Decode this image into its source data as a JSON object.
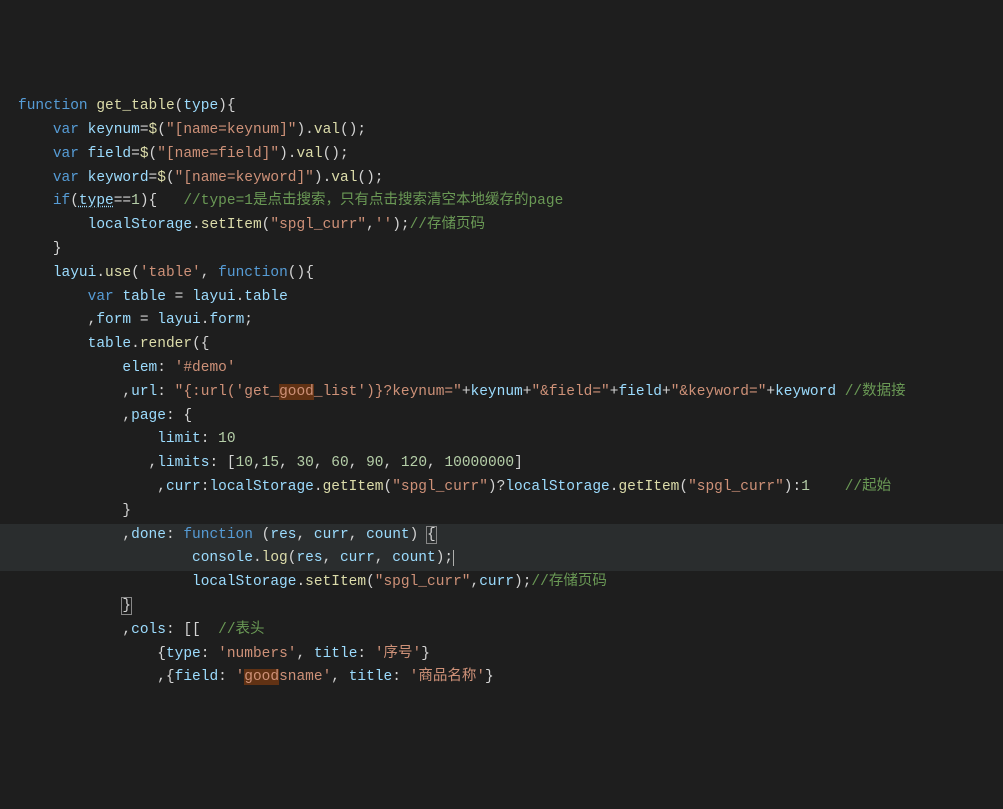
{
  "language": "javascript",
  "theme": "dark",
  "cursor_line": 19,
  "cursor_col": 55,
  "highlighted_lines": [
    19,
    20
  ],
  "code_lines": [
    {
      "tokens": [
        {
          "t": "function",
          "c": "kw"
        },
        {
          "t": " ",
          "c": "op"
        },
        {
          "t": "get_table",
          "c": "fn"
        },
        {
          "t": "(",
          "c": "pun"
        },
        {
          "t": "type",
          "c": "var"
        },
        {
          "t": "){",
          "c": "pun"
        }
      ]
    },
    {
      "indent": 4,
      "tokens": [
        {
          "t": "var",
          "c": "kw"
        },
        {
          "t": " ",
          "c": "op"
        },
        {
          "t": "keynum",
          "c": "var"
        },
        {
          "t": "=",
          "c": "op"
        },
        {
          "t": "$",
          "c": "fn"
        },
        {
          "t": "(",
          "c": "pun"
        },
        {
          "t": "\"[name=keynum]\"",
          "c": "str"
        },
        {
          "t": ").",
          "c": "pun"
        },
        {
          "t": "val",
          "c": "fn"
        },
        {
          "t": "();",
          "c": "pun"
        }
      ]
    },
    {
      "indent": 4,
      "tokens": [
        {
          "t": "var",
          "c": "kw"
        },
        {
          "t": " ",
          "c": "op"
        },
        {
          "t": "field",
          "c": "var"
        },
        {
          "t": "=",
          "c": "op"
        },
        {
          "t": "$",
          "c": "fn"
        },
        {
          "t": "(",
          "c": "pun"
        },
        {
          "t": "\"[name=field]\"",
          "c": "str"
        },
        {
          "t": ").",
          "c": "pun"
        },
        {
          "t": "val",
          "c": "fn"
        },
        {
          "t": "();",
          "c": "pun"
        }
      ]
    },
    {
      "indent": 4,
      "tokens": [
        {
          "t": "var",
          "c": "kw"
        },
        {
          "t": " ",
          "c": "op"
        },
        {
          "t": "keyword",
          "c": "var"
        },
        {
          "t": "=",
          "c": "op"
        },
        {
          "t": "$",
          "c": "fn"
        },
        {
          "t": "(",
          "c": "pun"
        },
        {
          "t": "\"[name=keyword]\"",
          "c": "str"
        },
        {
          "t": ").",
          "c": "pun"
        },
        {
          "t": "val",
          "c": "fn"
        },
        {
          "t": "();",
          "c": "pun"
        }
      ]
    },
    {
      "indent": 4,
      "tokens": [
        {
          "t": "if",
          "c": "kw"
        },
        {
          "t": "(",
          "c": "pun"
        },
        {
          "t": "type",
          "c": "var",
          "u": true
        },
        {
          "t": "==",
          "c": "op"
        },
        {
          "t": "1",
          "c": "num"
        },
        {
          "t": "){   ",
          "c": "pun"
        },
        {
          "t": "//type=1是点击搜索，只有点击搜索清空本地缓存的page",
          "c": "cmt"
        }
      ]
    },
    {
      "indent": 8,
      "tokens": [
        {
          "t": "localStorage",
          "c": "var"
        },
        {
          "t": ".",
          "c": "pun"
        },
        {
          "t": "setItem",
          "c": "fn"
        },
        {
          "t": "(",
          "c": "pun"
        },
        {
          "t": "\"spgl_curr\"",
          "c": "str"
        },
        {
          "t": ",",
          "c": "pun"
        },
        {
          "t": "''",
          "c": "str"
        },
        {
          "t": ");",
          "c": "pun"
        },
        {
          "t": "//存储页码",
          "c": "cmt"
        }
      ]
    },
    {
      "indent": 4,
      "tokens": [
        {
          "t": "}",
          "c": "pun"
        }
      ]
    },
    {
      "indent": 4,
      "tokens": [
        {
          "t": "layui",
          "c": "var"
        },
        {
          "t": ".",
          "c": "pun"
        },
        {
          "t": "use",
          "c": "fn"
        },
        {
          "t": "(",
          "c": "pun"
        },
        {
          "t": "'table'",
          "c": "str"
        },
        {
          "t": ", ",
          "c": "pun"
        },
        {
          "t": "function",
          "c": "kw"
        },
        {
          "t": "(){",
          "c": "pun"
        }
      ]
    },
    {
      "indent": 8,
      "tokens": [
        {
          "t": "var",
          "c": "kw"
        },
        {
          "t": " ",
          "c": "op"
        },
        {
          "t": "table",
          "c": "var"
        },
        {
          "t": " = ",
          "c": "op"
        },
        {
          "t": "layui",
          "c": "var"
        },
        {
          "t": ".",
          "c": "pun"
        },
        {
          "t": "table",
          "c": "var"
        }
      ]
    },
    {
      "indent": 8,
      "tokens": [
        {
          "t": ",",
          "c": "pun"
        },
        {
          "t": "form",
          "c": "var"
        },
        {
          "t": " = ",
          "c": "op"
        },
        {
          "t": "layui",
          "c": "var"
        },
        {
          "t": ".",
          "c": "pun"
        },
        {
          "t": "form",
          "c": "var"
        },
        {
          "t": ";",
          "c": "pun"
        }
      ]
    },
    {
      "indent": 8,
      "tokens": [
        {
          "t": "table",
          "c": "var"
        },
        {
          "t": ".",
          "c": "pun"
        },
        {
          "t": "render",
          "c": "fn"
        },
        {
          "t": "({",
          "c": "pun"
        }
      ]
    },
    {
      "indent": 12,
      "tokens": [
        {
          "t": "elem",
          "c": "var"
        },
        {
          "t": ": ",
          "c": "pun"
        },
        {
          "t": "'#demo'",
          "c": "str"
        }
      ]
    },
    {
      "indent": 12,
      "tokens": [
        {
          "t": ",",
          "c": "pun"
        },
        {
          "t": "url",
          "c": "var"
        },
        {
          "t": ": ",
          "c": "pun"
        },
        {
          "t": "\"{:url('get_",
          "c": "str"
        },
        {
          "t": "good",
          "c": "str",
          "box": true
        },
        {
          "t": "_list')}?keynum=\"",
          "c": "str"
        },
        {
          "t": "+",
          "c": "op"
        },
        {
          "t": "keynum",
          "c": "var"
        },
        {
          "t": "+",
          "c": "op"
        },
        {
          "t": "\"&field=\"",
          "c": "str"
        },
        {
          "t": "+",
          "c": "op"
        },
        {
          "t": "field",
          "c": "var"
        },
        {
          "t": "+",
          "c": "op"
        },
        {
          "t": "\"&keyword=\"",
          "c": "str"
        },
        {
          "t": "+",
          "c": "op"
        },
        {
          "t": "keyword",
          "c": "var"
        },
        {
          "t": " ",
          "c": "op"
        },
        {
          "t": "//数据接",
          "c": "cmt"
        }
      ]
    },
    {
      "indent": 12,
      "tokens": [
        {
          "t": ",",
          "c": "pun"
        },
        {
          "t": "page",
          "c": "var"
        },
        {
          "t": ": {",
          "c": "pun"
        }
      ]
    },
    {
      "indent": 16,
      "tokens": [
        {
          "t": "limit",
          "c": "var"
        },
        {
          "t": ": ",
          "c": "pun"
        },
        {
          "t": "10",
          "c": "num"
        }
      ]
    },
    {
      "indent": 15,
      "tokens": [
        {
          "t": ",",
          "c": "pun"
        },
        {
          "t": "limits",
          "c": "var"
        },
        {
          "t": ": [",
          "c": "pun"
        },
        {
          "t": "10",
          "c": "num"
        },
        {
          "t": ",",
          "c": "pun"
        },
        {
          "t": "15",
          "c": "num"
        },
        {
          "t": ", ",
          "c": "pun"
        },
        {
          "t": "30",
          "c": "num"
        },
        {
          "t": ", ",
          "c": "pun"
        },
        {
          "t": "60",
          "c": "num"
        },
        {
          "t": ", ",
          "c": "pun"
        },
        {
          "t": "90",
          "c": "num"
        },
        {
          "t": ", ",
          "c": "pun"
        },
        {
          "t": "120",
          "c": "num"
        },
        {
          "t": ", ",
          "c": "pun"
        },
        {
          "t": "10000000",
          "c": "num"
        },
        {
          "t": "]",
          "c": "pun"
        }
      ]
    },
    {
      "indent": 16,
      "tokens": [
        {
          "t": ",",
          "c": "pun"
        },
        {
          "t": "curr",
          "c": "var"
        },
        {
          "t": ":",
          "c": "pun"
        },
        {
          "t": "localStorage",
          "c": "var"
        },
        {
          "t": ".",
          "c": "pun"
        },
        {
          "t": "getItem",
          "c": "fn"
        },
        {
          "t": "(",
          "c": "pun"
        },
        {
          "t": "\"spgl_curr\"",
          "c": "str"
        },
        {
          "t": ")?",
          "c": "pun"
        },
        {
          "t": "localStorage",
          "c": "var"
        },
        {
          "t": ".",
          "c": "pun"
        },
        {
          "t": "getItem",
          "c": "fn"
        },
        {
          "t": "(",
          "c": "pun"
        },
        {
          "t": "\"spgl_curr\"",
          "c": "str"
        },
        {
          "t": "):",
          "c": "pun"
        },
        {
          "t": "1",
          "c": "num"
        },
        {
          "t": "    ",
          "c": "op"
        },
        {
          "t": "//起始",
          "c": "cmt"
        }
      ]
    },
    {
      "indent": 12,
      "tokens": [
        {
          "t": "}",
          "c": "pun"
        }
      ]
    },
    {
      "indent": 12,
      "hl": true,
      "tokens": [
        {
          "t": ",",
          "c": "pun"
        },
        {
          "t": "done",
          "c": "var"
        },
        {
          "t": ": ",
          "c": "pun"
        },
        {
          "t": "function",
          "c": "kw"
        },
        {
          "t": " (",
          "c": "pun"
        },
        {
          "t": "res",
          "c": "var"
        },
        {
          "t": ", ",
          "c": "pun"
        },
        {
          "t": "curr",
          "c": "var"
        },
        {
          "t": ", ",
          "c": "pun"
        },
        {
          "t": "count",
          "c": "var"
        },
        {
          "t": ") ",
          "c": "pun"
        },
        {
          "t": "{",
          "c": "pun",
          "bracketbox": true
        }
      ]
    },
    {
      "indent": 20,
      "hl": true,
      "tokens": [
        {
          "t": "console",
          "c": "var"
        },
        {
          "t": ".",
          "c": "pun"
        },
        {
          "t": "log",
          "c": "fn"
        },
        {
          "t": "(",
          "c": "pun"
        },
        {
          "t": "res",
          "c": "var"
        },
        {
          "t": ", ",
          "c": "pun"
        },
        {
          "t": "curr",
          "c": "var"
        },
        {
          "t": ", ",
          "c": "pun"
        },
        {
          "t": "count",
          "c": "var"
        },
        {
          "t": ");",
          "c": "pun",
          "cursor": true
        }
      ]
    },
    {
      "indent": 20,
      "tokens": [
        {
          "t": "localStorage",
          "c": "var"
        },
        {
          "t": ".",
          "c": "pun"
        },
        {
          "t": "setItem",
          "c": "fn"
        },
        {
          "t": "(",
          "c": "pun"
        },
        {
          "t": "\"spgl_curr\"",
          "c": "str"
        },
        {
          "t": ",",
          "c": "pun"
        },
        {
          "t": "curr",
          "c": "var"
        },
        {
          "t": ");",
          "c": "pun"
        },
        {
          "t": "//存储页码",
          "c": "cmt"
        }
      ]
    },
    {
      "indent": 12,
      "tokens": [
        {
          "t": "}",
          "c": "pun",
          "bracketbox": true
        }
      ]
    },
    {
      "indent": 12,
      "tokens": [
        {
          "t": ",",
          "c": "pun"
        },
        {
          "t": "cols",
          "c": "var"
        },
        {
          "t": ": [[  ",
          "c": "pun"
        },
        {
          "t": "//表头",
          "c": "cmt"
        }
      ]
    },
    {
      "indent": 16,
      "tokens": [
        {
          "t": "{",
          "c": "pun"
        },
        {
          "t": "type",
          "c": "var"
        },
        {
          "t": ": ",
          "c": "pun"
        },
        {
          "t": "'numbers'",
          "c": "str"
        },
        {
          "t": ", ",
          "c": "pun"
        },
        {
          "t": "title",
          "c": "var"
        },
        {
          "t": ": ",
          "c": "pun"
        },
        {
          "t": "'序号'",
          "c": "str"
        },
        {
          "t": "}",
          "c": "pun"
        }
      ]
    },
    {
      "indent": 16,
      "tokens": [
        {
          "t": ",{",
          "c": "pun"
        },
        {
          "t": "field",
          "c": "var"
        },
        {
          "t": ": ",
          "c": "pun"
        },
        {
          "t": "'",
          "c": "str"
        },
        {
          "t": "good",
          "c": "str",
          "box": true
        },
        {
          "t": "sname'",
          "c": "str"
        },
        {
          "t": ", ",
          "c": "pun"
        },
        {
          "t": "title",
          "c": "var"
        },
        {
          "t": ": ",
          "c": "pun"
        },
        {
          "t": "'商品名称'",
          "c": "str"
        },
        {
          "t": "}",
          "c": "pun"
        }
      ]
    }
  ]
}
